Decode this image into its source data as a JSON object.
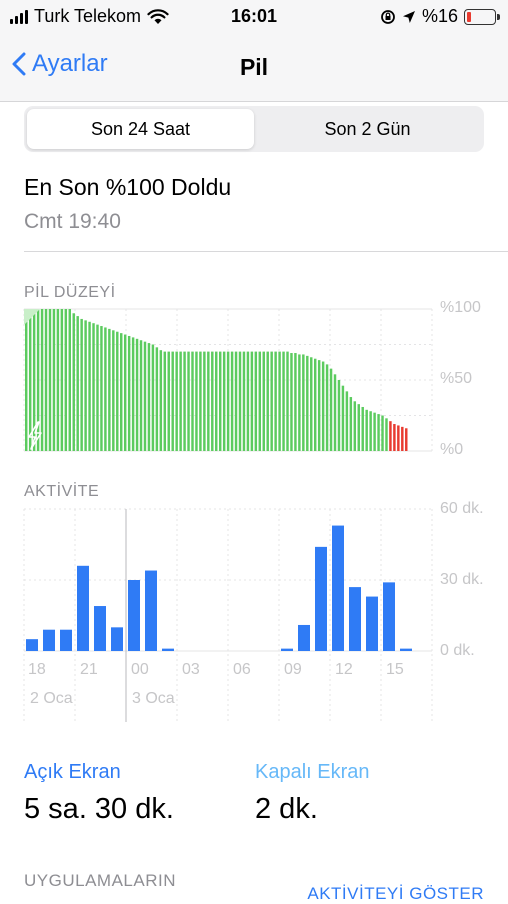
{
  "status_bar": {
    "carrier": "Turk Telekom",
    "time": "16:01",
    "battery_text": "%16",
    "battery_level": 0.16,
    "icons": [
      "signal-icon",
      "wifi-icon",
      "orientation-lock-icon",
      "location-icon",
      "battery-icon"
    ]
  },
  "nav": {
    "back_label": "Ayarlar",
    "title": "Pil"
  },
  "segments": {
    "items": [
      "Son 24 Saat",
      "Son 2 Gün"
    ],
    "selected": 0
  },
  "last_charge": {
    "title": "En Son %100 Doldu",
    "time": "Cmt 19:40"
  },
  "colors": {
    "accent": "#2f7bf5",
    "battery_green": "#5ccb5f",
    "battery_red": "#e83b30",
    "screen_off": "#66b8f8",
    "activity_bar": "#2f7bf5"
  },
  "battery_chart": {
    "label": "PİL DÜZEYİ",
    "y_ticks": [
      "%100",
      "%50",
      "%0"
    ]
  },
  "activity_chart": {
    "label": "AKTİVİTE",
    "y_ticks": [
      "60 dk.",
      "30 dk.",
      "0 dk."
    ],
    "x_ticks": [
      "18",
      "21",
      "00",
      "03",
      "06",
      "09",
      "12",
      "15"
    ],
    "day_labels": [
      "2 Oca",
      "3 Oca"
    ]
  },
  "chart_data": [
    {
      "type": "bar",
      "title": "PİL DÜZEYİ",
      "ylabel": "",
      "ylim": [
        0,
        100
      ],
      "y_ticks": [
        "%100",
        "%50",
        "%0"
      ],
      "grid": true,
      "values": [
        100,
        100,
        100,
        100,
        100,
        100,
        100,
        100,
        100,
        100,
        100,
        100,
        97,
        95,
        93,
        92,
        91,
        90,
        89,
        88,
        87,
        86,
        85,
        84,
        83,
        82,
        81,
        80,
        79,
        78,
        77,
        76,
        75,
        73,
        71,
        70,
        70,
        70,
        70,
        70,
        70,
        70,
        70,
        70,
        70,
        70,
        70,
        70,
        70,
        70,
        70,
        70,
        70,
        70,
        70,
        70,
        70,
        70,
        70,
        70,
        70,
        70,
        70,
        70,
        70,
        70,
        70,
        69,
        69,
        68,
        68,
        67,
        66,
        65,
        64,
        63,
        61,
        58,
        54,
        50,
        46,
        42,
        38,
        35,
        33,
        31,
        29,
        28,
        27,
        26,
        25,
        23,
        21,
        19,
        18,
        17,
        16
      ],
      "low_from_index": 92
    },
    {
      "type": "bar",
      "title": "AKTİVİTE",
      "xlabel": "",
      "ylabel": "",
      "ylim": [
        0,
        60
      ],
      "y_ticks": [
        "60 dk.",
        "30 dk.",
        "0 dk."
      ],
      "x_ticks": [
        "18",
        "21",
        "00",
        "03",
        "06",
        "09",
        "12",
        "15"
      ],
      "categories": [
        "17",
        "18",
        "19",
        "20",
        "21",
        "22",
        "23",
        "00",
        "01",
        "02",
        "03",
        "04",
        "05",
        "06",
        "07",
        "08",
        "09",
        "10",
        "11",
        "12",
        "13",
        "14",
        "15",
        "16"
      ],
      "values": [
        5,
        9,
        9,
        36,
        19,
        10,
        30,
        34,
        1,
        0,
        0,
        0,
        0,
        0,
        0,
        1,
        11,
        44,
        53,
        27,
        23,
        29,
        1,
        0
      ],
      "grid": true
    }
  ],
  "usage": {
    "screen_on_label": "Açık Ekran",
    "screen_on_value": "5 sa. 30 dk.",
    "screen_off_label": "Kapalı Ekran",
    "screen_off_value": "2 dk."
  },
  "apps": {
    "label": "UYGULAMALARIN",
    "show_activity_label": "AKTİVİTEYİ GÖSTER"
  }
}
